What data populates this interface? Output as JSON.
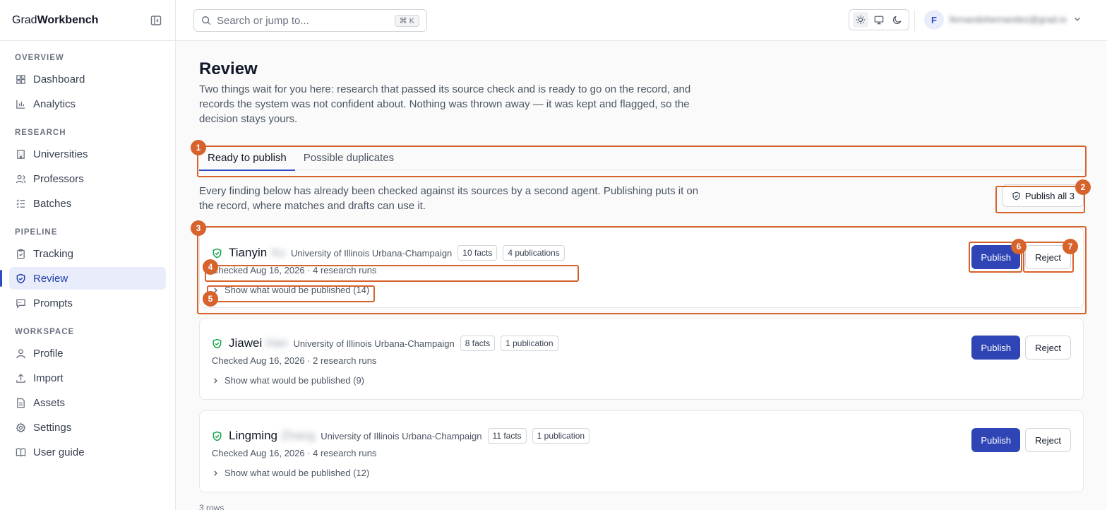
{
  "brand": {
    "prefix": "Grad",
    "bold": "Workbench"
  },
  "search": {
    "placeholder": "Search or jump to...",
    "shortcut": "⌘ K"
  },
  "user": {
    "initial": "F",
    "name": "fernandohernandez@grad.io"
  },
  "sidebar": {
    "sections": [
      {
        "title": "OVERVIEW",
        "items": [
          {
            "label": "Dashboard",
            "icon": "dashboard-icon"
          },
          {
            "label": "Analytics",
            "icon": "analytics-icon"
          }
        ]
      },
      {
        "title": "RESEARCH",
        "items": [
          {
            "label": "Universities",
            "icon": "building-icon"
          },
          {
            "label": "Professors",
            "icon": "users-icon"
          },
          {
            "label": "Batches",
            "icon": "list-icon"
          }
        ]
      },
      {
        "title": "PIPELINE",
        "items": [
          {
            "label": "Tracking",
            "icon": "clipboard-icon"
          },
          {
            "label": "Review",
            "icon": "shield-icon",
            "active": true
          },
          {
            "label": "Prompts",
            "icon": "message-icon"
          }
        ]
      },
      {
        "title": "WORKSPACE",
        "items": [
          {
            "label": "Profile",
            "icon": "user-icon"
          },
          {
            "label": "Import",
            "icon": "upload-icon"
          },
          {
            "label": "Assets",
            "icon": "file-icon"
          },
          {
            "label": "Settings",
            "icon": "gear-icon"
          },
          {
            "label": "User guide",
            "icon": "book-icon"
          }
        ]
      }
    ]
  },
  "page": {
    "title": "Review",
    "description": "Two things wait for you here: research that passed its source check and is ready to go on the record, and records the system was not confident about. Nothing was thrown away — it was kept and flagged, so the decision stays yours.",
    "tabs": [
      "Ready to publish",
      "Possible duplicates"
    ],
    "intro": "Every finding below has already been checked against its sources by a second agent. Publishing puts it on the record, where matches and drafts can use it.",
    "publish_all": "Publish all 3",
    "rows_count": "3 rows"
  },
  "cards": [
    {
      "first": "Tianyin",
      "last": "Xu",
      "university": "University of Illinois Urbana-Champaign",
      "facts": "10 facts",
      "pubs": "4 publications",
      "meta": "Checked Aug 16, 2026 · 4 research runs",
      "toggle": "Show what would be published (14)",
      "publish": "Publish",
      "reject": "Reject"
    },
    {
      "first": "Jiawei",
      "last": "Han",
      "university": "University of Illinois Urbana-Champaign",
      "facts": "8 facts",
      "pubs": "1 publication",
      "meta": "Checked Aug 16, 2026 · 2 research runs",
      "toggle": "Show what would be published (9)",
      "publish": "Publish",
      "reject": "Reject"
    },
    {
      "first": "Lingming",
      "last": "Zhang",
      "university": "University of Illinois Urbana-Champaign",
      "facts": "11 facts",
      "pubs": "1 publication",
      "meta": "Checked Aug 16, 2026 · 4 research runs",
      "toggle": "Show what would be published (12)",
      "publish": "Publish",
      "reject": "Reject"
    }
  ],
  "annotations": [
    "1",
    "2",
    "3",
    "4",
    "5",
    "6",
    "7"
  ],
  "colors": {
    "accent": "#2f45b5",
    "annotation": "#d6622c",
    "success": "#16a34a"
  }
}
